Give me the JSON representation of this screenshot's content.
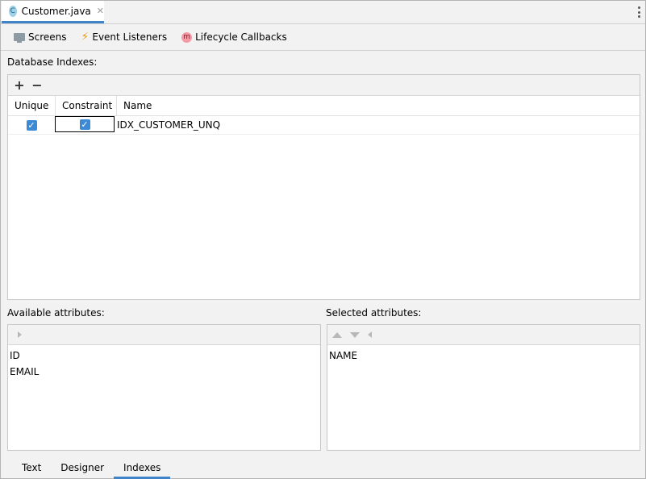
{
  "editor_tab": {
    "icon_letter": "C",
    "filename": "Customer.java",
    "close_glyph": "✕"
  },
  "toolbar": {
    "screens_label": "Screens",
    "event_listeners_label": "Event Listeners",
    "lifecycle_label": "Lifecycle Callbacks",
    "lifecycle_icon_letter": "m"
  },
  "database_indexes": {
    "label": "Database Indexes:",
    "add_glyph": "+",
    "remove_glyph": "−",
    "columns": [
      "Unique",
      "Constraint",
      "Name"
    ],
    "rows": [
      {
        "unique": true,
        "constraint": true,
        "name": "IDX_CUSTOMER_UNQ"
      }
    ]
  },
  "available_attributes": {
    "label": "Available attributes:",
    "items": [
      "ID",
      "EMAIL"
    ]
  },
  "selected_attributes": {
    "label": "Selected attributes:",
    "items": [
      "NAME"
    ]
  },
  "bottom_tabs": [
    {
      "label": "Text",
      "active": false
    },
    {
      "label": "Designer",
      "active": false
    },
    {
      "label": "Indexes",
      "active": true
    }
  ],
  "colors": {
    "accent": "#4083c9",
    "checkbox": "#3c8ad6"
  }
}
